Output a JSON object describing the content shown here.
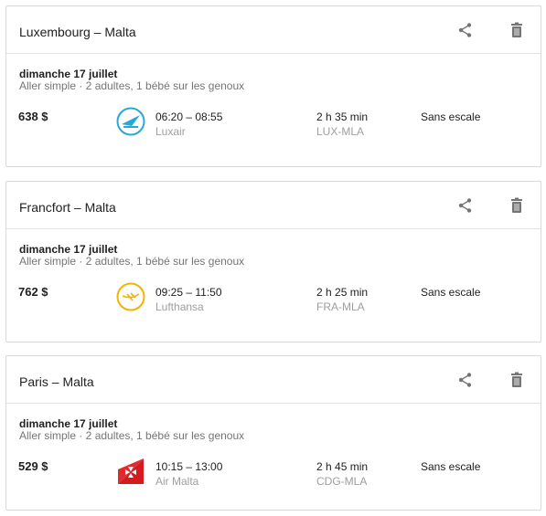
{
  "cards": [
    {
      "route": "Luxembourg – Malta",
      "date": "dimanche 17 juillet",
      "passengers": "Aller simple · 2 adultes, 1 bébé sur les genoux",
      "price": "638 $",
      "times": "06:20 – 08:55",
      "airline": "Luxair",
      "duration": "2 h 35 min",
      "airports": "LUX-MLA",
      "stops": "Sans escale",
      "logo_icon": "luxair-logo-icon",
      "logo_color": "#2aa7d6"
    },
    {
      "route": "Francfort – Malta",
      "date": "dimanche 17 juillet",
      "passengers": "Aller simple · 2 adultes, 1 bébé sur les genoux",
      "price": "762 $",
      "times": "09:25 – 11:50",
      "airline": "Lufthansa",
      "duration": "2 h 25 min",
      "airports": "FRA-MLA",
      "stops": "Sans escale",
      "logo_icon": "lufthansa-logo-icon",
      "logo_color": "#f5b300"
    },
    {
      "route": "Paris – Malta",
      "date": "dimanche 17 juillet",
      "passengers": "Aller simple · 2 adultes, 1 bébé sur les genoux",
      "price": "529 $",
      "times": "10:15 – 13:00",
      "airline": "Air Malta",
      "duration": "2 h 45 min",
      "airports": "CDG-MLA",
      "stops": "Sans escale",
      "logo_icon": "air-malta-logo-icon",
      "logo_color": "#d71920"
    }
  ],
  "icons": {
    "share": "share-icon",
    "delete": "trash-icon"
  }
}
